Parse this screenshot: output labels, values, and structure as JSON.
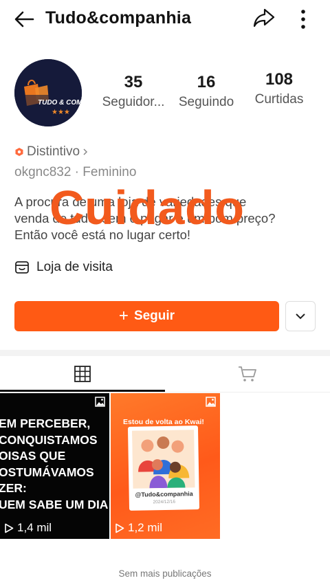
{
  "header": {
    "title": "Tudo&companhia",
    "back_icon": "arrow-left-icon",
    "share_icon": "share-icon",
    "more_icon": "more-vertical-icon"
  },
  "profile": {
    "avatar_text": "TUDO & COM",
    "stats": [
      {
        "value": "35",
        "label": "Seguidor..."
      },
      {
        "value": "16",
        "label": "Seguindo"
      },
      {
        "value": "108",
        "label": "Curtidas"
      }
    ],
    "badge": "Distintivo",
    "meta": "okgnc832 · Feminino",
    "bio": [
      "A procura de uma loja de variedades que",
      "venda de tudo, sem o pagar e um bom preço?",
      "Então você está no lugar certo!"
    ],
    "watermark": "Cuidado",
    "shop_label": "Loja de visita"
  },
  "actions": {
    "follow_label": "Seguir"
  },
  "tabs": [
    {
      "icon": "grid-icon",
      "active": true
    },
    {
      "icon": "cart-icon",
      "active": false
    }
  ],
  "posts": [
    {
      "lines": [
        "EM PERCEBER,",
        "CONQUISTAMOS",
        "OISAS QUE",
        "OSTUMÁVAMOS",
        "ZER:",
        "UEM SABE UM DIA"
      ],
      "views": "1,4 mil"
    },
    {
      "headline": "Estou de volta ao Kwai!",
      "handle": "@Tudo&companhia",
      "date": "2024/12/16",
      "views": "1,2 mil"
    }
  ],
  "footer": {
    "no_more": "Sem mais publicações"
  },
  "colors": {
    "accent": "#ff5a14",
    "watermark": "#f25a1d"
  }
}
